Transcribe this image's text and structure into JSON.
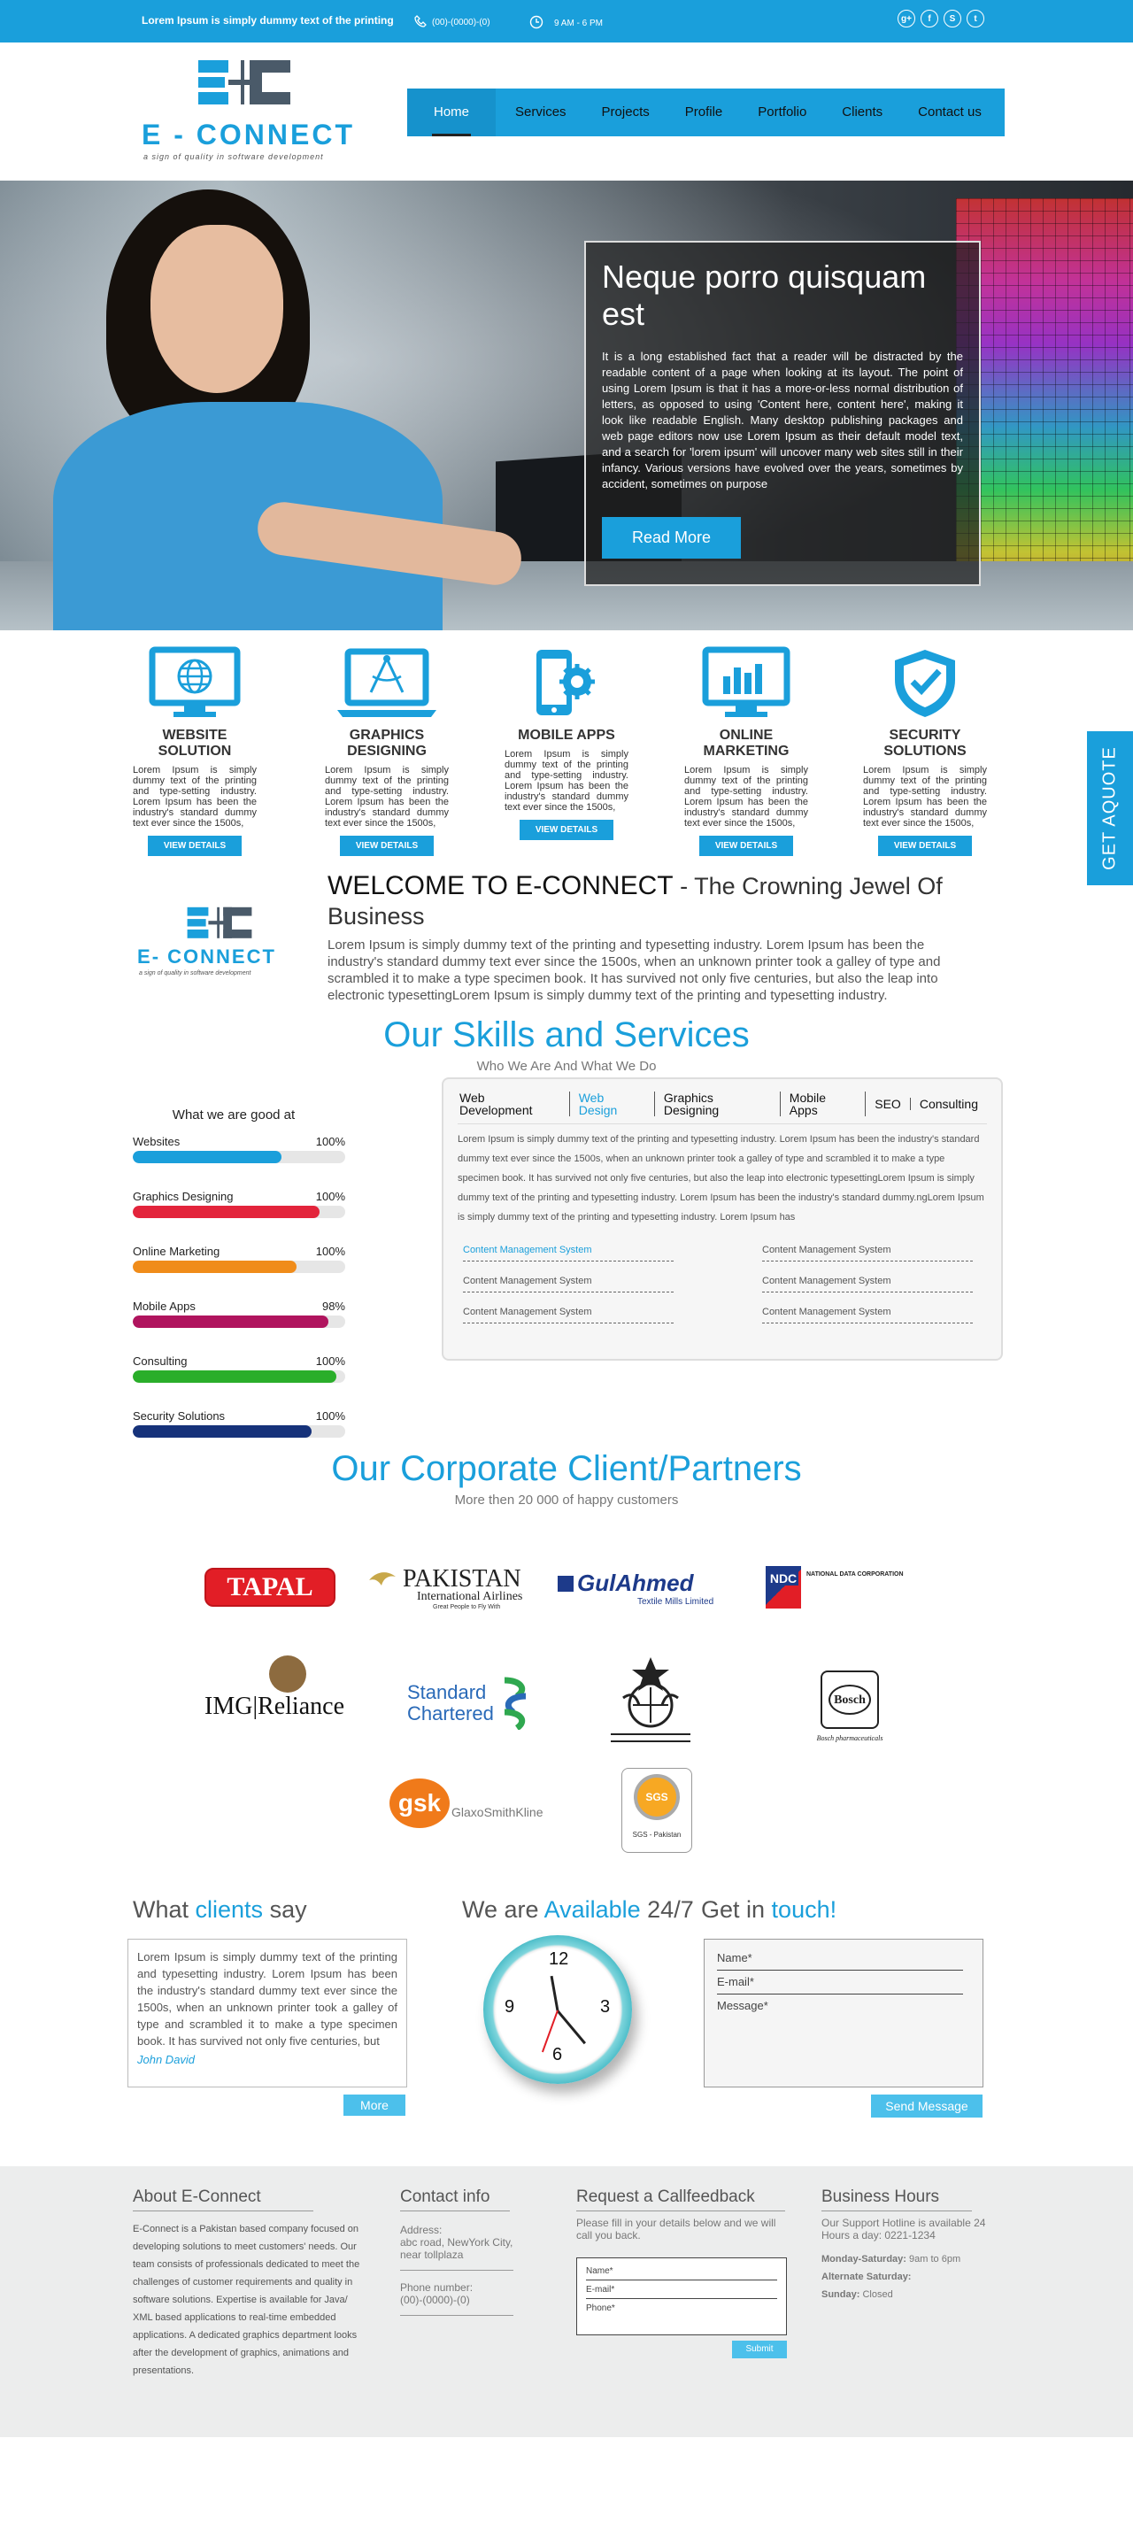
{
  "topbar": {
    "tagline": "Lorem Ipsum is simply dummy text of the printing",
    "phone": "(00)-(0000)-(0)",
    "hours": "9 AM - 6 PM",
    "social": [
      "g+",
      "f",
      "S",
      "t"
    ]
  },
  "logo": {
    "brand_a": "E",
    "brand_b": "- CONNECT",
    "slogan": "a sign of quality in software development"
  },
  "nav": [
    {
      "label": "Home",
      "active": true
    },
    {
      "label": "Services"
    },
    {
      "label": "Projects"
    },
    {
      "label": "Profile"
    },
    {
      "label": "Portfolio"
    },
    {
      "label": "Clients"
    },
    {
      "label": "Contact us"
    }
  ],
  "hero": {
    "title": "Neque porro quisquam est",
    "body": "It is a long established fact that a reader will be distracted by the readable content of a page when looking at its layout. The point of using Lorem Ipsum is that it has a more-or-less normal distribution of letters, as opposed to using 'Content here, content here', making it look like readable English. Many desktop publishing packages and web page editors now use Lorem Ipsum as their default model text, and a search for 'lorem ipsum' will uncover many web sites still in their infancy. Various versions have evolved over the years, sometimes by accident, sometimes on purpose",
    "button": "Read More"
  },
  "services": [
    {
      "title": "WEBSITE SOLUTION",
      "icon": "globe-monitor-icon",
      "text": "Lorem Ipsum is simply dummy text of the printing and type-setting industry. Lorem Ipsum has been the industry's standard dummy text ever since the 1500s,",
      "button": "VIEW DETAILS"
    },
    {
      "title": "GRAPHICS DESIGNING",
      "icon": "laptop-compass-icon",
      "text": "Lorem Ipsum is simply dummy text of the printing and type-setting industry. Lorem Ipsum has been the industry's standard dummy text ever since the 1500s,",
      "button": "VIEW DETAILS"
    },
    {
      "title": "MOBILE APPS",
      "icon": "phone-gear-icon",
      "text": "Lorem Ipsum is simply dummy text of the printing and type-setting industry. Lorem Ipsum has been the industry's standard dummy text ever since the 1500s,",
      "button": "VIEW DETAILS"
    },
    {
      "title": "ONLINE MARKETING",
      "icon": "chart-monitor-icon",
      "text": "Lorem Ipsum is simply dummy text of the printing and type-setting industry. Lorem Ipsum has been the industry's standard dummy text ever since the 1500s,",
      "button": "VIEW DETAILS"
    },
    {
      "title": "SECURITY SOLUTIONS",
      "icon": "shield-check-icon",
      "text": "Lorem Ipsum is simply dummy text of the printing and type-setting industry. Lorem Ipsum has been the industry's standard dummy text ever since the 1500s,",
      "button": "VIEW DETAILS"
    }
  ],
  "quote_tab": "GET AQUOTE",
  "welcome": {
    "title": "WELCOME TO E-CONNECT",
    "subtitle": " - The Crowning Jewel Of Business",
    "body": "Lorem Ipsum is simply dummy text of the printing and typesetting industry. Lorem Ipsum has been the industry's standard dummy text ever since the 1500s, when an unknown printer took a galley of type and scrambled it to make a type specimen book. It has survived not only five centuries, but also the leap into electronic typesettingLorem Ipsum is simply dummy text of the printing and typesetting industry."
  },
  "skills": {
    "heading": "Our Skills and Services",
    "sub": "Who We Are And What We Do",
    "bars_title": "What we are good at",
    "bars": [
      {
        "label": "Websites",
        "pct_label": "100%",
        "fill": 0.7,
        "color": "#1a9fdb"
      },
      {
        "label": "Graphics Designing",
        "pct_label": "100%",
        "fill": 0.88,
        "color": "#e3243b"
      },
      {
        "label": "Online Marketing",
        "pct_label": "100%",
        "fill": 0.77,
        "color": "#f08c1a"
      },
      {
        "label": "Mobile Apps",
        "pct_label": "98%",
        "fill": 0.92,
        "color": "#b0145e"
      },
      {
        "label": "Consulting",
        "pct_label": "100%",
        "fill": 0.96,
        "color": "#2aae2a"
      },
      {
        "label": "Security Solutions",
        "pct_label": "100%",
        "fill": 0.84,
        "color": "#16327a"
      }
    ],
    "tabs": [
      {
        "label": "Web Development"
      },
      {
        "label": "Web Design",
        "active": true
      },
      {
        "label": "Graphics Designing"
      },
      {
        "label": "Mobile Apps"
      },
      {
        "label": "SEO"
      },
      {
        "label": "Consulting"
      }
    ],
    "tab_text": "Lorem Ipsum is simply dummy text of the printing and typesetting industry. Lorem Ipsum has been the industry's standard dummy text ever since the 1500s, when an unknown printer took a galley of type and scrambled it to make a type specimen book. It has survived not only five centuries, but also the leap into electronic typesettingLorem Ipsum is simply dummy text of the printing and typesetting industry. Lorem Ipsum has been the industry's standard dummy.ngLorem Ipsum is simply dummy text of the printing and typesetting industry. Lorem Ipsum has",
    "cms_items": [
      {
        "label": "Content Management System",
        "active": true
      },
      {
        "label": "Content Management System"
      },
      {
        "label": "Content Management System"
      },
      {
        "label": "Content Management System"
      },
      {
        "label": "Content Management System"
      },
      {
        "label": "Content Management System"
      }
    ]
  },
  "clients": {
    "heading": "Our Corporate Client/Partners",
    "sub": "More then 20 000 of happy customers",
    "logos": {
      "tapal": "TAPAL",
      "pia_a": "PAKISTAN",
      "pia_b": "International Airlines",
      "pia_c": "Great People to Fly With",
      "gul_a": "GulAhmed",
      "gul_b": "Textile Mills Limited",
      "ndc_a": "NDC",
      "ndc_b": "NATIONAL DATA CORPORATION",
      "img": "IMG|Reliance",
      "sc_a": "Standard",
      "sc_b": "Chartered",
      "bosch": "Bosch",
      "bosch_b": "Bosch pharmaceuticals",
      "gsk_a": "gsk",
      "gsk_b": "GlaxoSmithKline",
      "sgs": "SGS",
      "sgs_b": "SGS - Pakistan"
    }
  },
  "testimonial": {
    "title_a": "What ",
    "title_b": "clients",
    "title_c": " say",
    "text": "Lorem Ipsum is simply dummy text of the printing and typesetting industry. Lorem Ipsum has been the industry's standard dummy text ever since the 1500s, when an unknown printer took a galley of type and scrambled it to make a type specimen book. It has survived not only five centuries, but",
    "author": "John David",
    "button": "More"
  },
  "available": {
    "title_a": "We are ",
    "title_b": "Available",
    "title_c": " 24/7",
    "numbers": [
      "12",
      "3",
      "6",
      "9"
    ]
  },
  "contact": {
    "title_a": "Get in ",
    "title_b": "touch!",
    "fields": [
      "Name*",
      "E-mail*",
      "Message*"
    ],
    "button": "Send Message"
  },
  "footer": {
    "about_title": "About E-Connect",
    "about_text": "E-Connect is a Pakistan based company focused on developing solutions to meet customers' needs. Our team consists of professionals dedicated to meet the challenges of customer requirements and quality in software solutions. Expertise is available for Java/ XML based applications to real-time embedded applications. A dedicated graphics department looks after the development of graphics, animations and presentations.",
    "contact_title": "Contact info",
    "address_label": "Address:",
    "address": "abc road, NewYork City, near tollplaza",
    "phone_label": "Phone number:",
    "phone": "(00)-(0000)-(0)",
    "callback_title": "Request a Callfeedback",
    "callback_text": "Please fill in your details below and we will call you back.",
    "callback_fields": [
      "Name*",
      "E-mail*",
      "Phone*"
    ],
    "submit": "Submit",
    "hours_title": "Business Hours",
    "hours_text": "Our Support Hotline is available 24 Hours a day: 0221-1234",
    "hours_a_label": "Monday-Saturday:",
    "hours_a": " 9am to 6pm",
    "hours_b_label": "Alternate Saturday:",
    "hours_c_label": "Sunday:",
    "hours_c": " Closed"
  }
}
